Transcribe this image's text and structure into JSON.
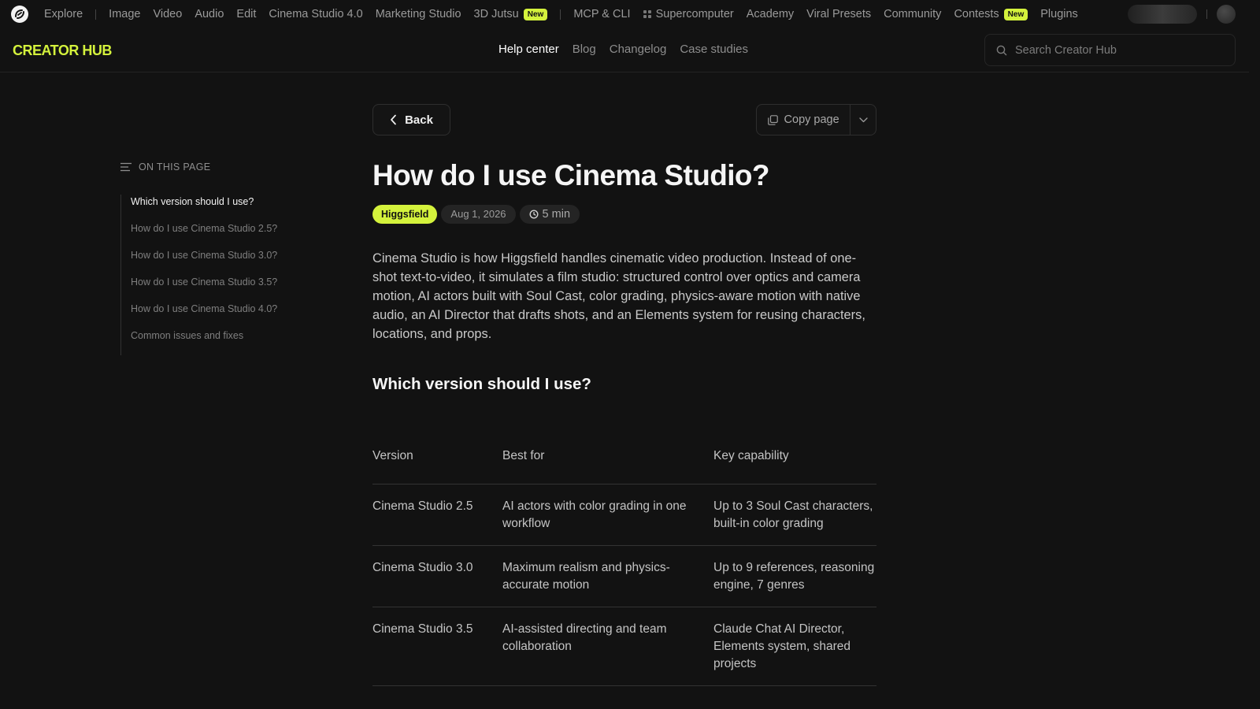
{
  "topnav": {
    "items": [
      {
        "label": "Explore"
      },
      {
        "label": "Image"
      },
      {
        "label": "Video"
      },
      {
        "label": "Audio"
      },
      {
        "label": "Edit"
      },
      {
        "label": "Cinema Studio 4.0"
      },
      {
        "label": "Marketing Studio"
      },
      {
        "label": "3D Jutsu",
        "badge": "New"
      },
      {
        "label": "MCP & CLI"
      },
      {
        "label": "Supercomputer"
      },
      {
        "label": "Academy"
      },
      {
        "label": "Viral Presets"
      },
      {
        "label": "Community"
      },
      {
        "label": "Contests",
        "badge": "New"
      },
      {
        "label": "Plugins"
      }
    ]
  },
  "subheader": {
    "brand": "CREATOR HUB",
    "tabs": [
      "Help center",
      "Blog",
      "Changelog",
      "Case studies"
    ],
    "active_tab": "Help center",
    "search_placeholder": "Search Creator Hub"
  },
  "toc": {
    "title": "ON THIS PAGE",
    "items": [
      "Which version should I use?",
      "How do I use Cinema Studio 2.5?",
      "How do I use Cinema Studio 3.0?",
      "How do I use Cinema Studio 3.5?",
      "How do I use Cinema Studio 4.0?",
      "Common issues and fixes"
    ],
    "active_index": 0
  },
  "article": {
    "back_label": "Back",
    "copy_label": "Copy page",
    "title": "How do I use Cinema Studio?",
    "author": "Higgsfield",
    "date": "Aug 1, 2026",
    "read_time": "5 min",
    "intro": "Cinema Studio is how Higgsfield handles cinematic video production. Instead of one-shot text-to-video, it simulates a film studio: structured control over optics and camera motion, AI actors built with Soul Cast, color grading, physics-aware motion with native audio, an AI Director that drafts shots, and an Elements system for reusing characters, locations, and props.",
    "section_heading": "Which version should I use?",
    "table": {
      "headers": [
        "Version",
        "Best for",
        "Key capability"
      ],
      "rows": [
        [
          "Cinema Studio 2.5",
          "AI actors with color grading in one workflow",
          "Up to 3 Soul Cast characters, built-in color grading"
        ],
        [
          "Cinema Studio 3.0",
          "Maximum realism and physics-accurate motion",
          "Up to 9 references, reasoning engine, 7 genres"
        ],
        [
          "Cinema Studio 3.5",
          "AI-assisted directing and team collaboration",
          "Claude Chat AI Director, Elements system, shared projects"
        ]
      ]
    }
  },
  "colors": {
    "background": "#121212",
    "accent": "#d4f23c",
    "text": "#e8e8e8",
    "muted": "#8d8d8d"
  },
  "icons": [
    "app-logo-icon",
    "grid-icon",
    "search-icon",
    "list-icon",
    "chevron-left-icon",
    "copy-icon",
    "chevron-down-icon",
    "clock-icon"
  ]
}
